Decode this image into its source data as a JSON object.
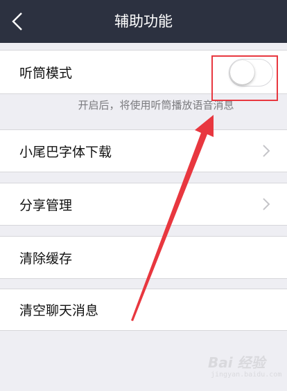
{
  "header": {
    "title": "辅助功能",
    "back_icon": "chevron-left-icon"
  },
  "settings": {
    "earpiece_mode": {
      "label": "听筒模式",
      "enabled": false,
      "hint": "开启后，将使用听筒播放语音消息"
    },
    "items": [
      {
        "label": "小尾巴字体下载",
        "has_chevron": true
      },
      {
        "label": "分享管理",
        "has_chevron": true
      },
      {
        "label": "清除缓存",
        "has_chevron": false
      },
      {
        "label": "清空聊天消息",
        "has_chevron": false
      }
    ]
  },
  "annotation": {
    "color": "#e8373f"
  },
  "watermark": {
    "logo": "Bai 经验",
    "url": "jingyan.baidu.com"
  },
  "colors": {
    "navbar": "#2c3140",
    "background": "#eeeef3",
    "row": "#ffffff",
    "hint_text": "#7a7a7e"
  }
}
